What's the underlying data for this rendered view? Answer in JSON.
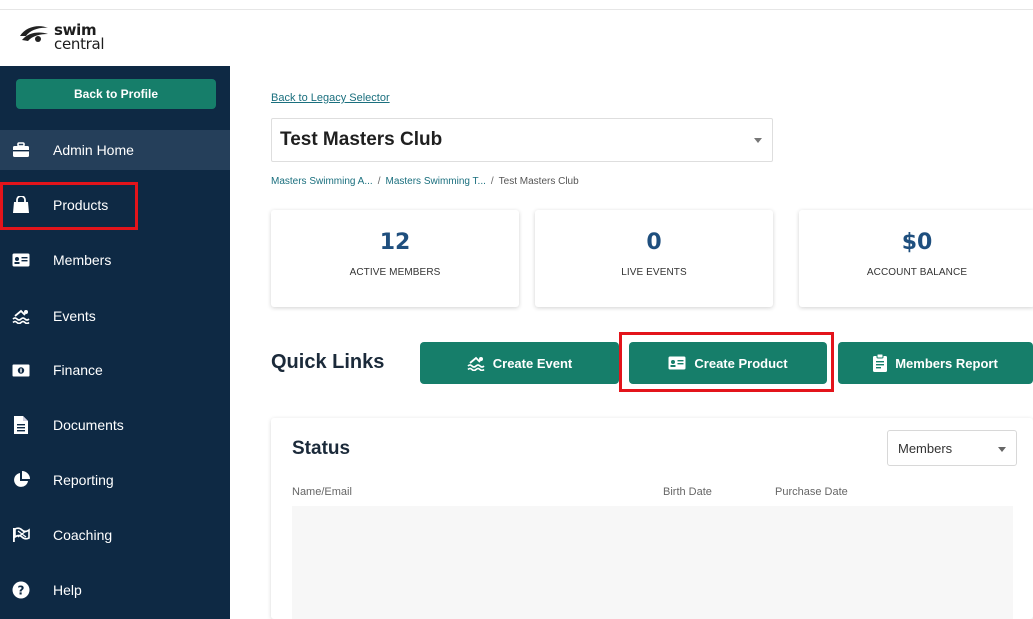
{
  "logo": {
    "line1": "swim",
    "line2": "central"
  },
  "sidebar": {
    "back_label": "Back to Profile",
    "items": [
      {
        "label": "Admin Home",
        "icon": "briefcase-icon"
      },
      {
        "label": "Products",
        "icon": "shopping-bag-icon"
      },
      {
        "label": "Members",
        "icon": "id-card-icon"
      },
      {
        "label": "Events",
        "icon": "swimmer-icon"
      },
      {
        "label": "Finance",
        "icon": "money-bill-icon"
      },
      {
        "label": "Documents",
        "icon": "document-icon"
      },
      {
        "label": "Reporting",
        "icon": "pie-chart-icon"
      },
      {
        "label": "Coaching",
        "icon": "flag-icon"
      },
      {
        "label": "Help",
        "icon": "question-circle-icon"
      }
    ]
  },
  "main": {
    "legacy_link": "Back to Legacy Selector",
    "club_select": "Test Masters Club",
    "breadcrumb": [
      "Masters Swimming A...",
      "Masters Swimming T...",
      "Test Masters Club"
    ],
    "breadcrumb_sep": "/",
    "stats": [
      {
        "value": "12",
        "label": "ACTIVE MEMBERS"
      },
      {
        "value": "0",
        "label": "LIVE EVENTS"
      },
      {
        "value": "$0",
        "label": "ACCOUNT BALANCE"
      }
    ],
    "quick_links": {
      "title": "Quick Links",
      "buttons": [
        {
          "label": "Create Event",
          "icon": "swimmer-icon"
        },
        {
          "label": "Create Product",
          "icon": "id-card-icon"
        },
        {
          "label": "Members Report",
          "icon": "clipboard-icon"
        }
      ]
    },
    "status": {
      "title": "Status",
      "filter": "Members",
      "columns": [
        "Name/Email",
        "Birth Date",
        "Purchase Date"
      ]
    }
  },
  "colors": {
    "sidebar_bg": "#0e2944",
    "sidebar_active": "#253f5a",
    "accent_green": "#167e6a",
    "highlight_red": "#e3141b",
    "stat_blue": "#1f4f7e"
  }
}
